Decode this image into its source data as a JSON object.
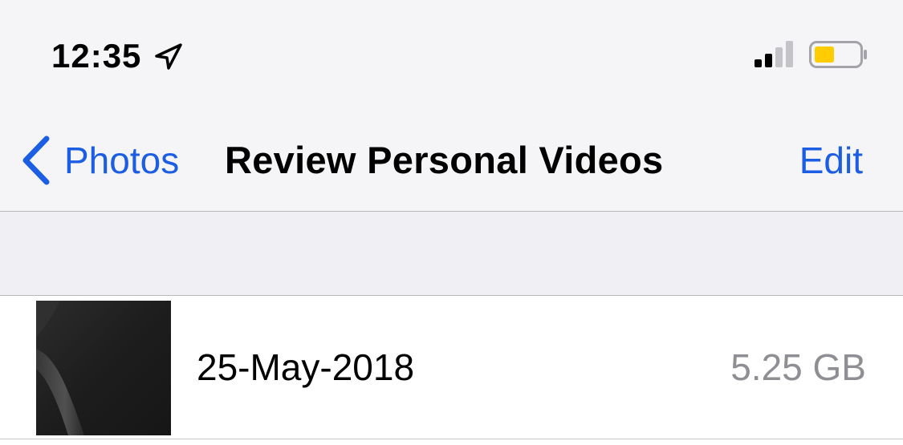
{
  "status_bar": {
    "time": "12:35",
    "location_icon": "location-arrow-icon",
    "signal_icon": "cellular-signal-icon",
    "battery_icon": "battery-icon",
    "battery_color": "#ffcc00"
  },
  "nav": {
    "back_label": "Photos",
    "back_icon": "chevron-left-icon",
    "title": "Review Personal Videos",
    "edit_label": "Edit",
    "tint_color": "#1c5ee3"
  },
  "videos": [
    {
      "title": "25-May-2018",
      "size": "5.25 GB",
      "thumbnail_icon": "video-thumbnail"
    }
  ]
}
